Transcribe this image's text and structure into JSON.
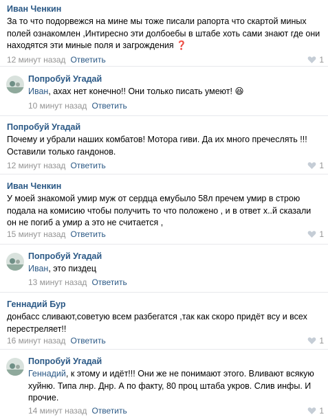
{
  "comments": [
    {
      "author": "Иван Ченкин",
      "text": "За то что подорвежся на мине мы тоже писали рапорта что скартой миных полей ознакомлен ,Интиресно эти долбоебы в штабе хоть сами знают где они находятся эти миные поля и загрождения",
      "emoji": "❓",
      "time": "12 минут назад",
      "reply": "Ответить",
      "likes": "1"
    },
    {
      "author": "Попробуй Угадай",
      "mention": "Иван",
      "text": ", ахах нет конечно!! Они только писать умеют!",
      "emoji": "😆",
      "time": "10 минут назад",
      "reply": "Ответить"
    },
    {
      "author": "Попробуй Угадай",
      "text": "Почему и убрали наших комбатов! Мотора гиви. Да их много пречеслять !!! Оставили только гандонов.",
      "time": "12 минут назад",
      "reply": "Ответить",
      "likes": "1"
    },
    {
      "author": "Иван Ченкин",
      "text": "У моей знакомой умир муж от сердца емубыло 58л пречем умир в строю подала на комисию чтобы получить то что положено , и в ответ х..й сказали он не погиб а умир а это не считается ,",
      "time": "15 минут назад",
      "reply": "Ответить",
      "likes": "1"
    },
    {
      "author": "Попробуй Угадай",
      "mention": "Иван",
      "text": ", это пиздец",
      "time": "13 минут назад",
      "reply": "Ответить"
    },
    {
      "author": "Геннадий Бур",
      "text": "донбасс сливают,советую всем разбегатся ,так как скоро придёт всу и всех перестреляет!!",
      "time": "16 минут назад",
      "reply": "Ответить",
      "likes": "1"
    },
    {
      "author": "Попробуй Угадай",
      "mention": "Геннадий",
      "text": ", к этому и идёт!!! Они же не понимают этого. Вливают всякую хуйню. Типа лнр. Днр. А по факту, 80 проц штаба укров. Слив инфы. И прочие.",
      "time": "14 минут назад",
      "reply": "Ответить",
      "likes": "1"
    }
  ],
  "colors": {
    "author": "#2a5885",
    "meta": "#939393",
    "divider": "#e7e8ec"
  },
  "icons": {
    "like": "heart-icon",
    "avatar": "avatar-image"
  }
}
